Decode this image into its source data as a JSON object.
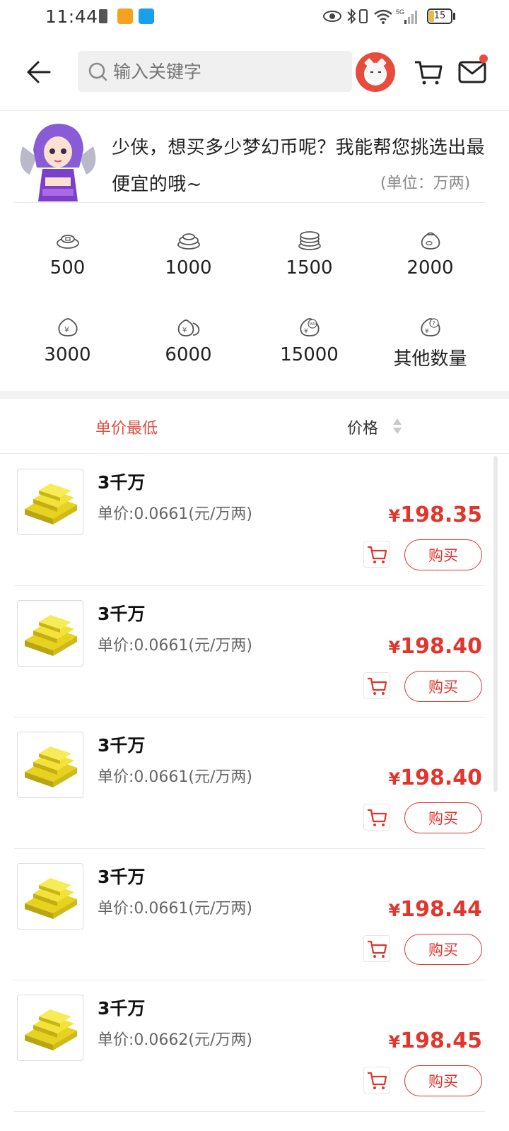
{
  "status_bar": {
    "time": "11:44",
    "battery": "15"
  },
  "header": {
    "search_placeholder": "输入关键字",
    "back_icon": "arrow-left-icon",
    "cart_icon": "cart-icon",
    "mail_icon": "mail-icon"
  },
  "intro": {
    "text": "少侠，想买多少梦幻币呢？我能帮您挑选出最便宜的哦~",
    "unit": "(单位：万两)"
  },
  "amounts": [
    {
      "label": "500",
      "icon": "coin-stack-small-icon"
    },
    {
      "label": "1000",
      "icon": "coin-stack-medium-icon"
    },
    {
      "label": "1500",
      "icon": "coin-stack-large-icon"
    },
    {
      "label": "2000",
      "icon": "money-bag-icon"
    },
    {
      "label": "3000",
      "icon": "money-bag-yen-icon"
    },
    {
      "label": "6000",
      "icon": "money-bags-yen-icon"
    },
    {
      "label": "15000",
      "icon": "money-bag-max-icon"
    },
    {
      "label": "其他数量",
      "icon": "money-bag-question-icon"
    }
  ],
  "sort": {
    "cheapest": "单价最低",
    "price": "价格"
  },
  "listings": [
    {
      "title": "3千万",
      "unit_price": "单价:0.0661(元/万两)",
      "currency": "¥",
      "price": "198.35",
      "buy": "购买"
    },
    {
      "title": "3千万",
      "unit_price": "单价:0.0661(元/万两)",
      "currency": "¥",
      "price": "198.40",
      "buy": "购买"
    },
    {
      "title": "3千万",
      "unit_price": "单价:0.0661(元/万两)",
      "currency": "¥",
      "price": "198.40",
      "buy": "购买"
    },
    {
      "title": "3千万",
      "unit_price": "单价:0.0661(元/万两)",
      "currency": "¥",
      "price": "198.44",
      "buy": "购买"
    },
    {
      "title": "3千万",
      "unit_price": "单价:0.0662(元/万两)",
      "currency": "¥",
      "price": "198.45",
      "buy": "购买"
    }
  ],
  "colors": {
    "accent": "#e2352c",
    "sort_active": "#e04b3d",
    "gold": "#f2e23a"
  }
}
